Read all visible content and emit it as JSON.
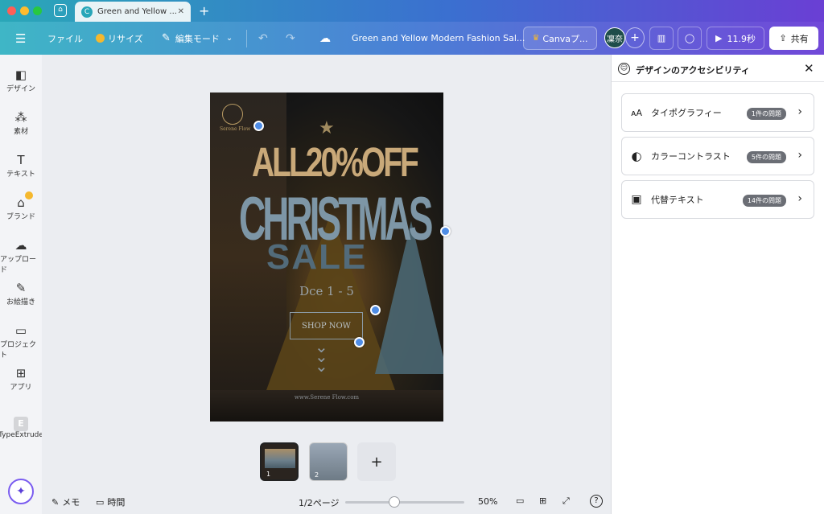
{
  "browser": {
    "tab_title": "Green and Yellow ...",
    "tab_icon_letter": "C",
    "new_tab": "+"
  },
  "toolbar": {
    "menu": "☰",
    "file": "ファイル",
    "resize": "リサイズ",
    "edit_mode": "編集モード",
    "doc_title": "Green and Yellow Modern Fashion Sal...",
    "canva_pro": "Canvaプ...",
    "avatar": "凜奈",
    "timer": "11.9秒",
    "share": "共有"
  },
  "sidebar": {
    "items": [
      {
        "label": "デザイン",
        "icon": "design-icon",
        "glyph": "◧"
      },
      {
        "label": "素材",
        "icon": "elements-icon",
        "glyph": "⁂"
      },
      {
        "label": "テキスト",
        "icon": "text-icon",
        "glyph": "T"
      },
      {
        "label": "ブランド",
        "icon": "brand-icon",
        "glyph": "⌂"
      },
      {
        "label": "アップロード",
        "icon": "upload-icon",
        "glyph": "☁"
      },
      {
        "label": "お絵描き",
        "icon": "draw-icon",
        "glyph": "✎"
      },
      {
        "label": "プロジェクト",
        "icon": "folder-icon",
        "glyph": "▭"
      },
      {
        "label": "アプリ",
        "icon": "apps-icon",
        "glyph": "⊞"
      },
      {
        "label": "TypeExtrude",
        "icon": "typeextrude-icon",
        "glyph": "E"
      }
    ]
  },
  "poster": {
    "brand": "Serene Flow",
    "line1": "ALL20%OFF",
    "line2": "CHRISTMAS",
    "line3": "SALE",
    "dates": "Dce 1 - 5",
    "cta": "SHOP NOW",
    "url": "www.Serene Flow.com"
  },
  "panel": {
    "title": "デザインのアクセシビリティ",
    "items": [
      {
        "label": "タイポグラフィー",
        "badge": "1件の問題",
        "icon": "typography-icon",
        "glyph": "ᴀA"
      },
      {
        "label": "カラーコントラスト",
        "badge": "5件の問題",
        "icon": "contrast-icon",
        "glyph": "◐"
      },
      {
        "label": "代替テキスト",
        "badge": "14件の問題",
        "icon": "image-icon",
        "glyph": "▣"
      }
    ]
  },
  "bottom": {
    "memo": "メモ",
    "time": "時間",
    "page": "1/2ページ",
    "zoom": "50%",
    "zoom_value": 0.5,
    "thumb1_num": "1",
    "thumb2_num": "2",
    "add_page": "+"
  }
}
